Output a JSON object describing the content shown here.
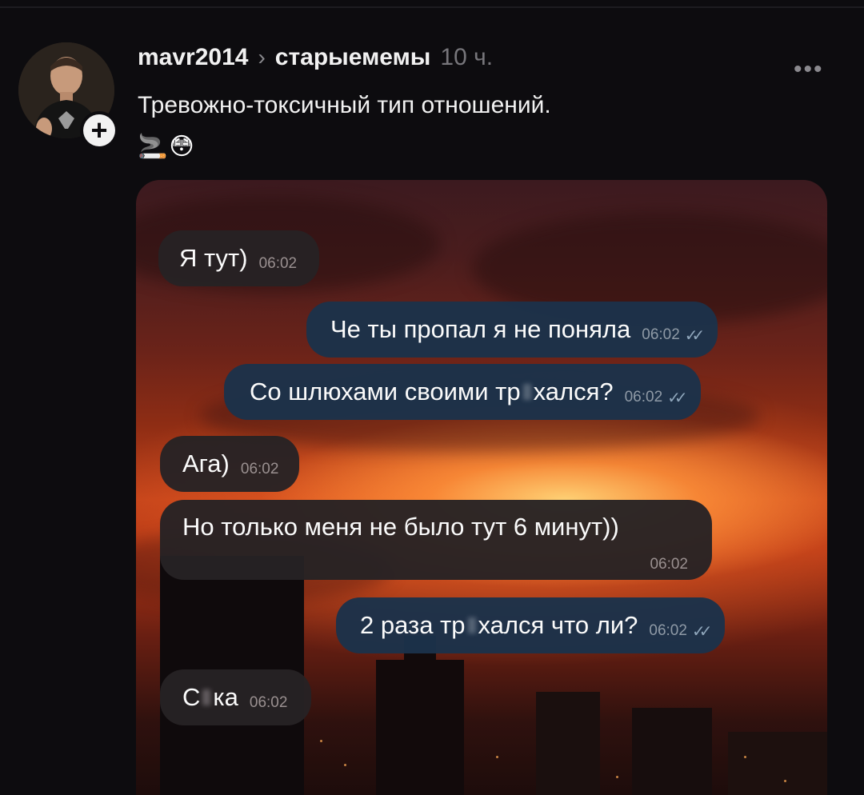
{
  "post": {
    "username": "mavr2014",
    "separator": "›",
    "community": "старыемемы",
    "time": "10 ч.",
    "more_label": "•••",
    "text": "Тревожно-токсичный тип отношений.",
    "emoji_1": "🚬",
    "emoji_2": "😳",
    "follow_label": "+"
  },
  "chat": {
    "messages": [
      {
        "side": "in",
        "text": "Я тут)",
        "time": "06:02"
      },
      {
        "side": "out",
        "text": "Че ты пропал я не поняла",
        "time": "06:02",
        "ticks": "✓✓"
      },
      {
        "side": "out",
        "text_a": "Со шлюхами своими тр",
        "text_b": "хался?",
        "time": "06:02",
        "ticks": "✓✓"
      },
      {
        "side": "in",
        "text": "Ага)",
        "time": "06:02"
      },
      {
        "side": "in",
        "text": "Но только меня не было тут 6 минут))",
        "time": "06:02"
      },
      {
        "side": "out",
        "text_a": "2 раза тр",
        "text_b": "хался что ли?",
        "time": "06:02",
        "ticks": "✓✓"
      },
      {
        "side": "in",
        "text_a": "С",
        "text_b": "ка",
        "time": "06:02"
      }
    ]
  },
  "colors": {
    "background": "#0d0c0f",
    "incoming_bubble": "#262224",
    "outgoing_bubble": "#1c324a",
    "sky_orange": "#c2421a"
  }
}
